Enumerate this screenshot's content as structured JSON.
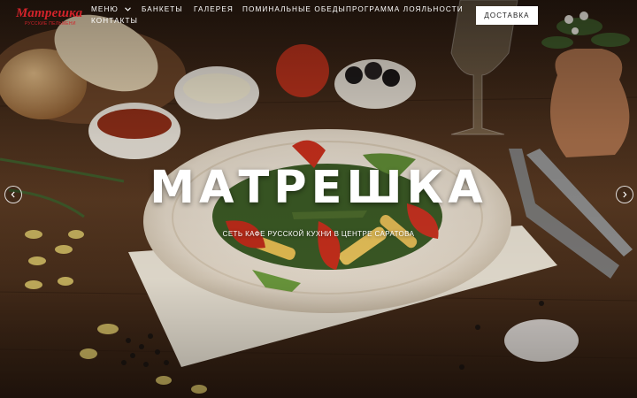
{
  "brand": {
    "name": "Матрешка",
    "tagline": "РУССКИЕ ПЕЛЬМЕНИ",
    "accent_color": "#d2232a"
  },
  "nav": {
    "items": [
      {
        "label": "МЕНЮ",
        "has_dropdown": true
      },
      {
        "label": "БАНКЕТЫ"
      },
      {
        "label": "ГАЛЕРЕЯ"
      },
      {
        "label": "ПОМИНАЛЬНЫЕ ОБЕДЫ"
      },
      {
        "label": "ПРОГРАММА ЛОЯЛЬНОСТИ"
      },
      {
        "label": "КОНТАКТЫ"
      }
    ],
    "dropdown_icon": "chevron-down-icon"
  },
  "cta": {
    "delivery_label": "ДОСТАВКА"
  },
  "hero": {
    "title": "МАТРЕШКА",
    "subtitle": "СЕТЬ КАФЕ РУССКОЙ КУХНИ В ЦЕНТРЕ САРАТОВА",
    "prev_icon": "chevron-left-icon",
    "next_icon": "chevron-right-icon"
  }
}
